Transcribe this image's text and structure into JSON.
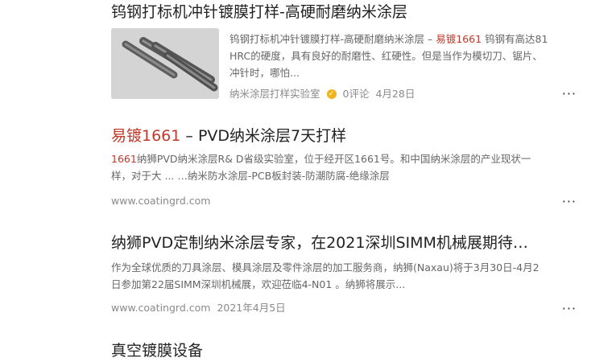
{
  "results": [
    {
      "title": "钨钢打标机冲针镀膜打样-高硬耐磨纳米涂层",
      "desc_line1_pre": "钨钢打标机冲针镀膜打样-高硬耐磨纳米涂层 – ",
      "desc_line1_hl": "易镀1661",
      "desc_line1_post": " 钨钢有高达81",
      "desc_line2": "HRC的硬度，具有良好的耐磨性、红硬性。但是当作为模切刀、锯片、",
      "desc_line3": "冲针时，哪怕...",
      "source": "纳米涂层打样实验室",
      "comments": "0评论",
      "date": "4月28日"
    },
    {
      "title_hl": "易镀1661",
      "title_rest": " – PVD纳米涂层7天打样",
      "desc_line1_hl": "1661",
      "desc_line1_post": "纳狮PVD纳米涂层R& D省级实验室，位于经开区1661号。和中国纳米涂层的产业现状一",
      "desc_line2": "样，对于大 ... …纳米防水涂层-PCB板封装-防潮防腐-绝缘涂层",
      "url": "www.coatingrd.com"
    },
    {
      "title": "纳狮PVD定制纳米涂层专家，在2021深圳SIMM机械展期待…",
      "desc_line1": "作为全球优质的刀具涂层、模具涂层及零件涂层的加工服务商，纳狮(Naxau)将于3月30日-4月2",
      "desc_line2": "日参加第22届SIMM深圳机械展，欢迎莅临4-N01 。纳狮将展示...",
      "url": "www.coatingrd.com",
      "date": "2021年4月5日"
    },
    {
      "title": "真空镀膜设备"
    }
  ],
  "more_label": "···"
}
